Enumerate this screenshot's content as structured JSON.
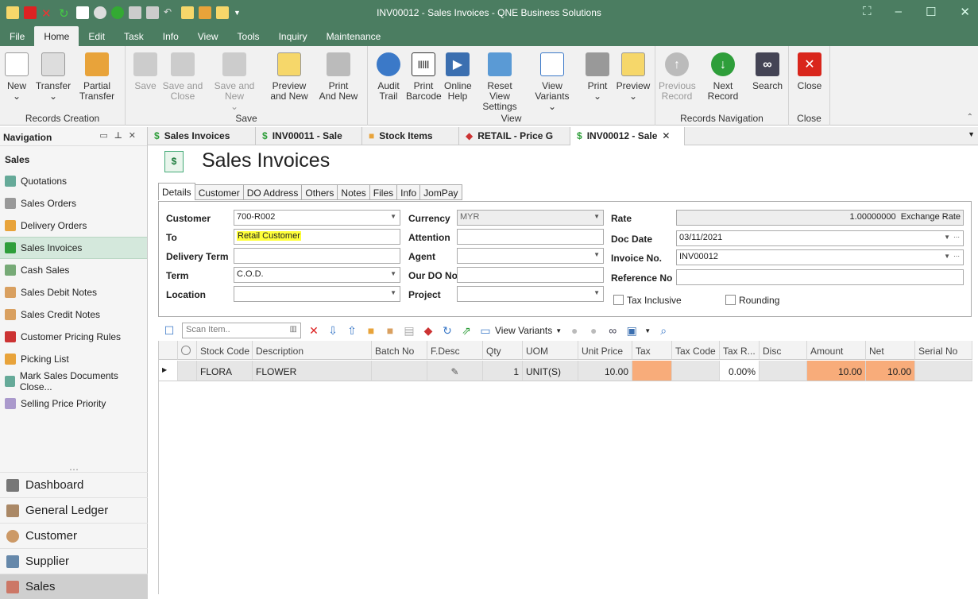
{
  "window": {
    "title": "INV00012 - Sales Invoices - QNE Business Solutions",
    "accent": "#4b7d61"
  },
  "menu": {
    "tabs": [
      "File",
      "Home",
      "Edit",
      "Task",
      "Info",
      "View",
      "Tools",
      "Inquiry",
      "Maintenance"
    ],
    "active": "Home"
  },
  "ribbon": {
    "groups": {
      "records_creation": "Records Creation",
      "save": "Save",
      "view": "View",
      "records_navigation": "Records Navigation",
      "close": "Close"
    },
    "buttons": {
      "new": "New",
      "transfer": "Transfer",
      "partial_transfer": "Partial\nTransfer",
      "save": "Save",
      "save_and_close": "Save and\nClose",
      "save_and_new": "Save and New",
      "preview_and_new": "Preview\nand New",
      "print_and_new": "Print\nAnd New",
      "audit_trail": "Audit\nTrail",
      "print_barcode": "Print\nBarcode",
      "online_help": "Online\nHelp",
      "reset_view": "Reset View\nSettings",
      "view_variants": "View Variants",
      "print": "Print",
      "preview": "Preview",
      "previous_record": "Previous\nRecord",
      "next_record": "Next Record",
      "search": "Search",
      "close": "Close"
    }
  },
  "nav": {
    "header": "Navigation",
    "section": "Sales",
    "items": [
      "Quotations",
      "Sales Orders",
      "Delivery Orders",
      "Sales Invoices",
      "Cash Sales",
      "Sales Debit Notes",
      "Sales Credit Notes",
      "Customer Pricing Rules",
      "Picking List",
      "Mark Sales Documents Close...",
      "Selling Price Priority"
    ],
    "selected": "Sales Invoices",
    "modules": [
      "Dashboard",
      "General Ledger",
      "Customer",
      "Supplier",
      "Sales"
    ]
  },
  "doctabs": [
    "Sales Invoices",
    "INV00011 - Sale",
    "Stock Items",
    "RETAIL - Price G",
    "INV00012 - Sale"
  ],
  "page": {
    "title": "Sales Invoices",
    "icon": "$"
  },
  "formtabs": [
    "Details",
    "Customer",
    "DO Address",
    "Others",
    "Notes",
    "Files",
    "Info",
    "JomPay"
  ],
  "form": {
    "labels": {
      "customer": "Customer",
      "to": "To",
      "delivery_term": "Delivery Term",
      "term": "Term",
      "location": "Location",
      "currency": "Currency",
      "attention": "Attention",
      "agent": "Agent",
      "our_do_no": "Our DO No",
      "project": "Project",
      "rate": "Rate",
      "doc_date": "Doc Date",
      "invoice_no": "Invoice No.",
      "reference_no": "Reference No",
      "tax_inclusive": "Tax Inclusive",
      "rounding": "Rounding"
    },
    "values": {
      "customer": "700-R002",
      "to": "Retail Customer",
      "delivery_term": "",
      "term": "C.O.D.",
      "location": "",
      "currency": "MYR",
      "attention": "",
      "agent": "",
      "our_do_no": "",
      "project": "",
      "rate": "1.00000000",
      "rate_suffix": "Exchange Rate",
      "doc_date": "03/11/2021",
      "invoice_no": "INV00012",
      "reference_no": ""
    }
  },
  "toolbar": {
    "scan_placeholder": "Scan Item..",
    "view_variants": "View Variants"
  },
  "grid": {
    "columns": [
      "Stock Code",
      "Description",
      "Batch No",
      "F.Desc",
      "Qty",
      "UOM",
      "Unit Price",
      "Tax",
      "Tax Code",
      "Tax R...",
      "Disc",
      "Amount",
      "Net",
      "Serial No"
    ],
    "rows": [
      {
        "stock_code": "FLORA",
        "description": "FLOWER",
        "batch_no": "",
        "qty": "1",
        "uom": "UNIT(S)",
        "unit_price": "10.00",
        "tax": "",
        "tax_code": "",
        "tax_rate": "0.00%",
        "disc": "",
        "amount": "10.00",
        "net": "10.00",
        "serial_no": ""
      }
    ]
  }
}
